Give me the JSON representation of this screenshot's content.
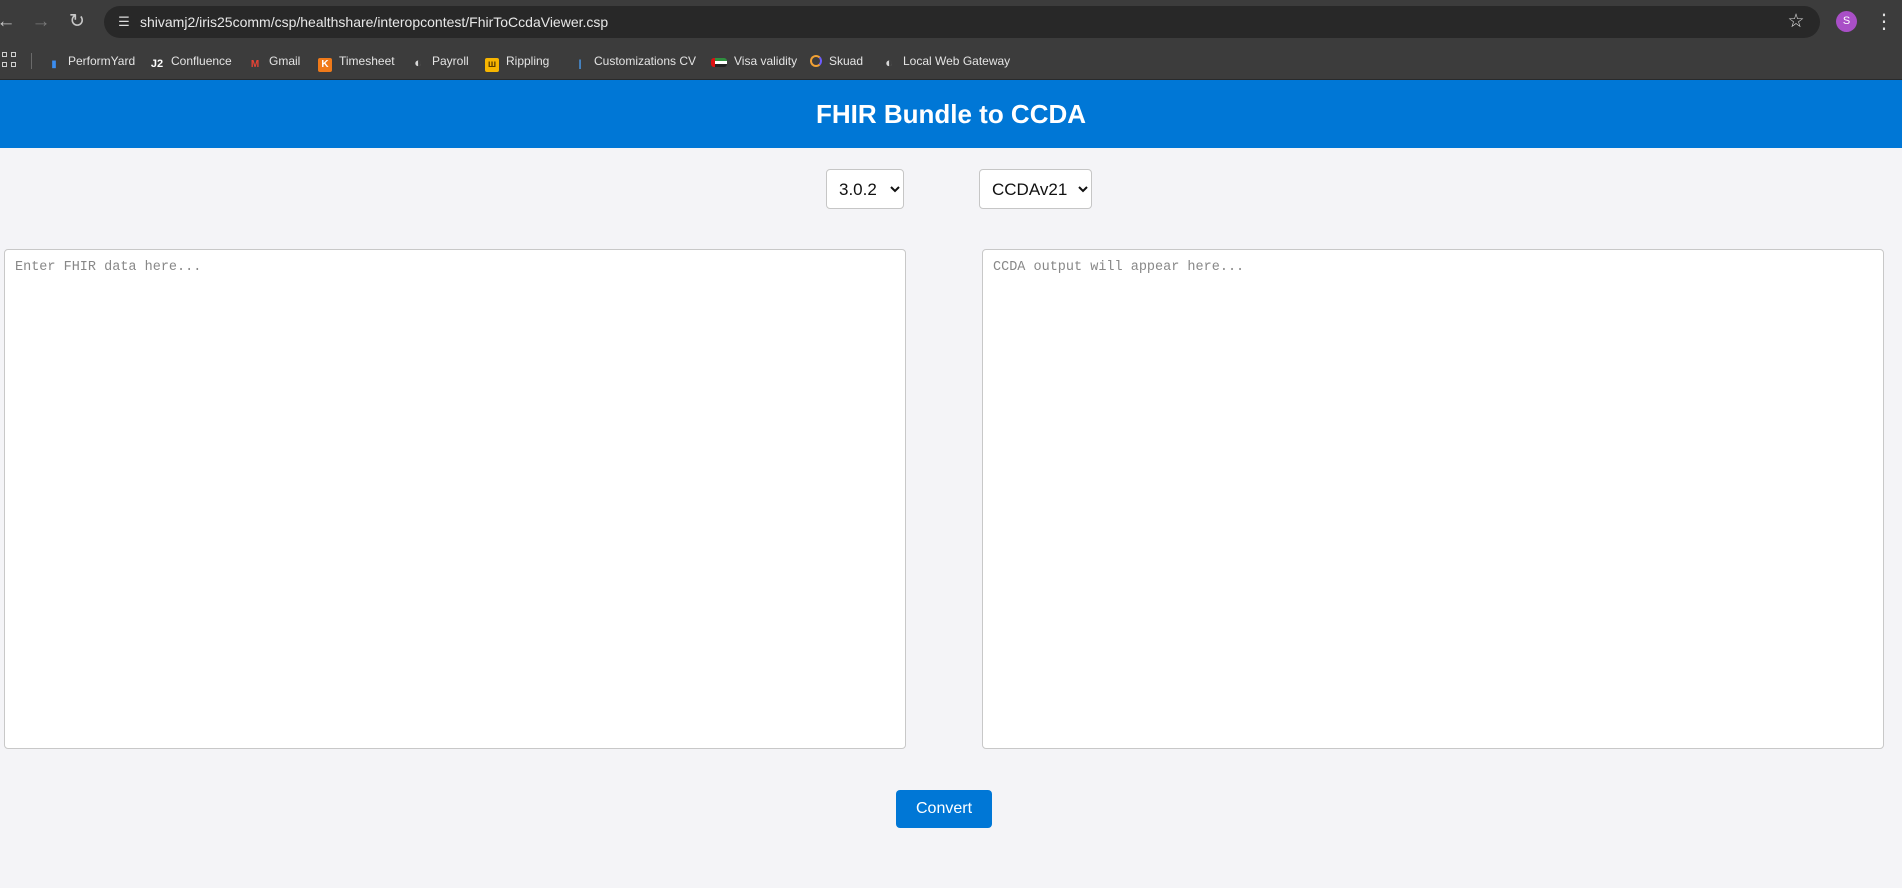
{
  "browser": {
    "url": "shivamj2/iris25comm/csp/healthshare/interopcontest/FhirToCcdaViewer.csp",
    "profile_initial": "S",
    "bookmarks": [
      {
        "label": "PerformYard",
        "icon": "performyard-icon"
      },
      {
        "label": "Confluence",
        "icon": "confluence-icon"
      },
      {
        "label": "Gmail",
        "icon": "gmail-icon"
      },
      {
        "label": "Timesheet",
        "icon": "timesheet-icon"
      },
      {
        "label": "Payroll",
        "icon": "globe-icon"
      },
      {
        "label": "Rippling",
        "icon": "rippling-icon"
      },
      {
        "label": "Customizations CV",
        "icon": "customizations-icon"
      },
      {
        "label": "Visa validity",
        "icon": "flag-icon"
      },
      {
        "label": "Skuad",
        "icon": "skuad-icon"
      },
      {
        "label": "Local Web Gateway",
        "icon": "globe-icon"
      }
    ]
  },
  "page": {
    "title": "FHIR Bundle to CCDA",
    "fhir_version": {
      "selected": "3.0.2"
    },
    "ccda_version": {
      "selected": "CCDAv21"
    },
    "input": {
      "placeholder": "Enter FHIR data here..."
    },
    "output": {
      "placeholder": "CCDA output will appear here..."
    },
    "convert_label": "Convert"
  },
  "colors": {
    "brand_blue": "#0077d6",
    "page_background": "#f4f4f7",
    "browser_chrome": "#3c3c3c",
    "profile_purple": "#a94fc7"
  }
}
